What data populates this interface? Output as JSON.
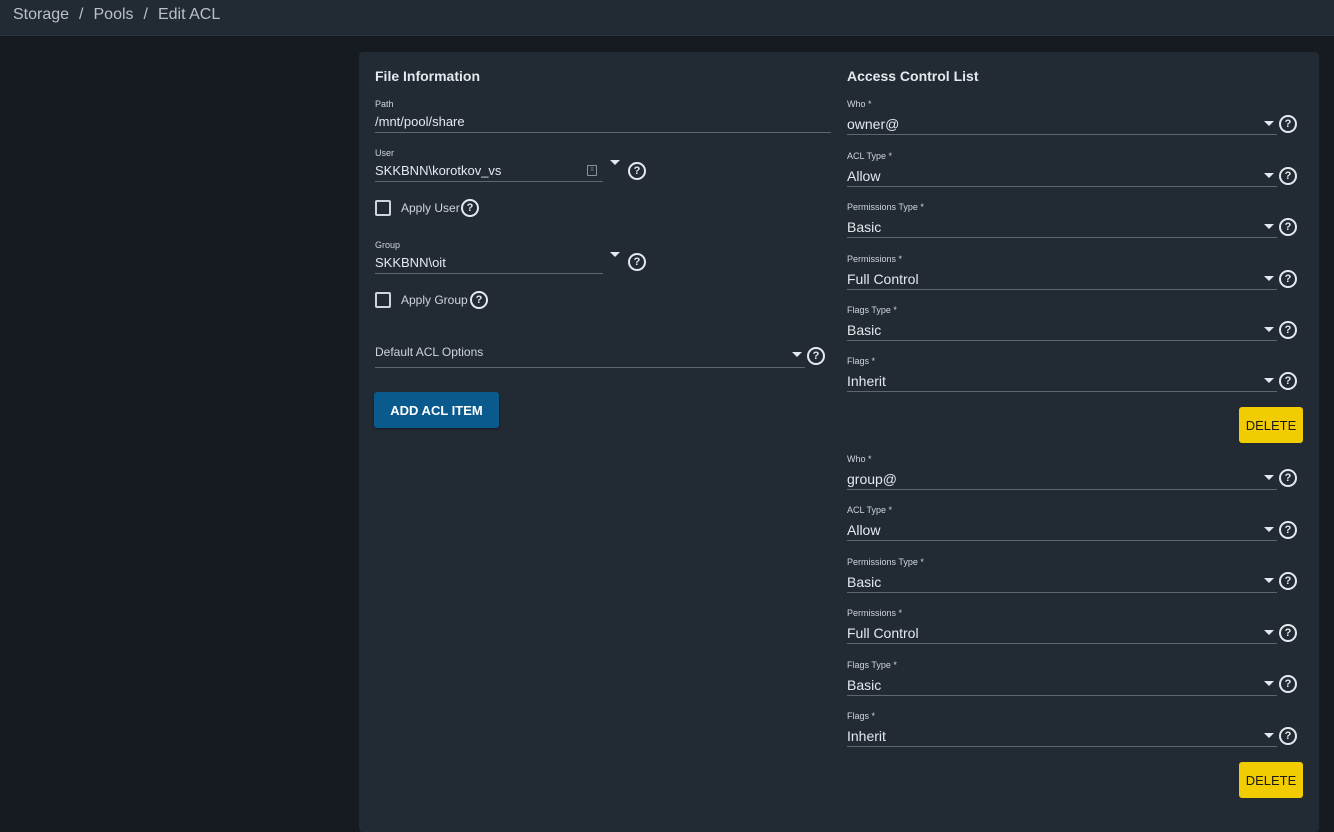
{
  "breadcrumb": {
    "items": [
      "Storage",
      "Pools",
      "Edit ACL"
    ],
    "separator": "/"
  },
  "file_info": {
    "title": "File Information",
    "path": {
      "label": "Path",
      "value": "/mnt/pool/share"
    },
    "user": {
      "label": "User",
      "value": "SKKBNN\\korotkov_vs"
    },
    "apply_user": {
      "label": "Apply User",
      "checked": false
    },
    "group": {
      "label": "Group",
      "value": "SKKBNN\\oit"
    },
    "apply_group": {
      "label": "Apply Group",
      "checked": false
    },
    "default_acl": {
      "placeholder": "Default ACL Options"
    },
    "add_button": "ADD ACL ITEM"
  },
  "acl": {
    "title": "Access Control List",
    "delete_label": "DELETE",
    "entries": [
      {
        "who": {
          "label": "Who *",
          "value": "owner@"
        },
        "acl_type": {
          "label": "ACL Type *",
          "value": "Allow"
        },
        "permissions_type": {
          "label": "Permissions Type *",
          "value": "Basic"
        },
        "permissions": {
          "label": "Permissions *",
          "value": "Full Control"
        },
        "flags_type": {
          "label": "Flags Type *",
          "value": "Basic"
        },
        "flags": {
          "label": "Flags *",
          "value": "Inherit"
        }
      },
      {
        "who": {
          "label": "Who *",
          "value": "group@"
        },
        "acl_type": {
          "label": "ACL Type *",
          "value": "Allow"
        },
        "permissions_type": {
          "label": "Permissions Type *",
          "value": "Basic"
        },
        "permissions": {
          "label": "Permissions *",
          "value": "Full Control"
        },
        "flags_type": {
          "label": "Flags Type *",
          "value": "Basic"
        },
        "flags": {
          "label": "Flags *",
          "value": "Inherit"
        }
      }
    ]
  },
  "colors": {
    "background": "#161b21",
    "card": "#222a33",
    "primary_button": "#0a5a8e",
    "delete_button": "#f0cc00"
  }
}
